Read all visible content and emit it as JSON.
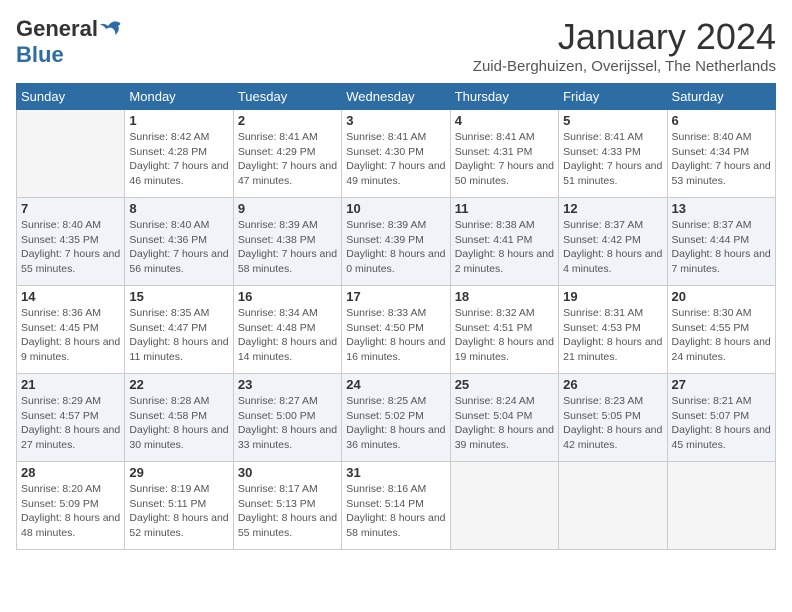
{
  "header": {
    "logo_general": "General",
    "logo_blue": "Blue",
    "month_title": "January 2024",
    "subtitle": "Zuid-Berghuizen, Overijssel, The Netherlands"
  },
  "days_of_week": [
    "Sunday",
    "Monday",
    "Tuesday",
    "Wednesday",
    "Thursday",
    "Friday",
    "Saturday"
  ],
  "weeks": [
    [
      {
        "num": "",
        "sunrise": "",
        "sunset": "",
        "daylight": "",
        "empty": true
      },
      {
        "num": "1",
        "sunrise": "Sunrise: 8:42 AM",
        "sunset": "Sunset: 4:28 PM",
        "daylight": "Daylight: 7 hours and 46 minutes."
      },
      {
        "num": "2",
        "sunrise": "Sunrise: 8:41 AM",
        "sunset": "Sunset: 4:29 PM",
        "daylight": "Daylight: 7 hours and 47 minutes."
      },
      {
        "num": "3",
        "sunrise": "Sunrise: 8:41 AM",
        "sunset": "Sunset: 4:30 PM",
        "daylight": "Daylight: 7 hours and 49 minutes."
      },
      {
        "num": "4",
        "sunrise": "Sunrise: 8:41 AM",
        "sunset": "Sunset: 4:31 PM",
        "daylight": "Daylight: 7 hours and 50 minutes."
      },
      {
        "num": "5",
        "sunrise": "Sunrise: 8:41 AM",
        "sunset": "Sunset: 4:33 PM",
        "daylight": "Daylight: 7 hours and 51 minutes."
      },
      {
        "num": "6",
        "sunrise": "Sunrise: 8:40 AM",
        "sunset": "Sunset: 4:34 PM",
        "daylight": "Daylight: 7 hours and 53 minutes."
      }
    ],
    [
      {
        "num": "7",
        "sunrise": "Sunrise: 8:40 AM",
        "sunset": "Sunset: 4:35 PM",
        "daylight": "Daylight: 7 hours and 55 minutes."
      },
      {
        "num": "8",
        "sunrise": "Sunrise: 8:40 AM",
        "sunset": "Sunset: 4:36 PM",
        "daylight": "Daylight: 7 hours and 56 minutes."
      },
      {
        "num": "9",
        "sunrise": "Sunrise: 8:39 AM",
        "sunset": "Sunset: 4:38 PM",
        "daylight": "Daylight: 7 hours and 58 minutes."
      },
      {
        "num": "10",
        "sunrise": "Sunrise: 8:39 AM",
        "sunset": "Sunset: 4:39 PM",
        "daylight": "Daylight: 8 hours and 0 minutes."
      },
      {
        "num": "11",
        "sunrise": "Sunrise: 8:38 AM",
        "sunset": "Sunset: 4:41 PM",
        "daylight": "Daylight: 8 hours and 2 minutes."
      },
      {
        "num": "12",
        "sunrise": "Sunrise: 8:37 AM",
        "sunset": "Sunset: 4:42 PM",
        "daylight": "Daylight: 8 hours and 4 minutes."
      },
      {
        "num": "13",
        "sunrise": "Sunrise: 8:37 AM",
        "sunset": "Sunset: 4:44 PM",
        "daylight": "Daylight: 8 hours and 7 minutes."
      }
    ],
    [
      {
        "num": "14",
        "sunrise": "Sunrise: 8:36 AM",
        "sunset": "Sunset: 4:45 PM",
        "daylight": "Daylight: 8 hours and 9 minutes."
      },
      {
        "num": "15",
        "sunrise": "Sunrise: 8:35 AM",
        "sunset": "Sunset: 4:47 PM",
        "daylight": "Daylight: 8 hours and 11 minutes."
      },
      {
        "num": "16",
        "sunrise": "Sunrise: 8:34 AM",
        "sunset": "Sunset: 4:48 PM",
        "daylight": "Daylight: 8 hours and 14 minutes."
      },
      {
        "num": "17",
        "sunrise": "Sunrise: 8:33 AM",
        "sunset": "Sunset: 4:50 PM",
        "daylight": "Daylight: 8 hours and 16 minutes."
      },
      {
        "num": "18",
        "sunrise": "Sunrise: 8:32 AM",
        "sunset": "Sunset: 4:51 PM",
        "daylight": "Daylight: 8 hours and 19 minutes."
      },
      {
        "num": "19",
        "sunrise": "Sunrise: 8:31 AM",
        "sunset": "Sunset: 4:53 PM",
        "daylight": "Daylight: 8 hours and 21 minutes."
      },
      {
        "num": "20",
        "sunrise": "Sunrise: 8:30 AM",
        "sunset": "Sunset: 4:55 PM",
        "daylight": "Daylight: 8 hours and 24 minutes."
      }
    ],
    [
      {
        "num": "21",
        "sunrise": "Sunrise: 8:29 AM",
        "sunset": "Sunset: 4:57 PM",
        "daylight": "Daylight: 8 hours and 27 minutes."
      },
      {
        "num": "22",
        "sunrise": "Sunrise: 8:28 AM",
        "sunset": "Sunset: 4:58 PM",
        "daylight": "Daylight: 8 hours and 30 minutes."
      },
      {
        "num": "23",
        "sunrise": "Sunrise: 8:27 AM",
        "sunset": "Sunset: 5:00 PM",
        "daylight": "Daylight: 8 hours and 33 minutes."
      },
      {
        "num": "24",
        "sunrise": "Sunrise: 8:25 AM",
        "sunset": "Sunset: 5:02 PM",
        "daylight": "Daylight: 8 hours and 36 minutes."
      },
      {
        "num": "25",
        "sunrise": "Sunrise: 8:24 AM",
        "sunset": "Sunset: 5:04 PM",
        "daylight": "Daylight: 8 hours and 39 minutes."
      },
      {
        "num": "26",
        "sunrise": "Sunrise: 8:23 AM",
        "sunset": "Sunset: 5:05 PM",
        "daylight": "Daylight: 8 hours and 42 minutes."
      },
      {
        "num": "27",
        "sunrise": "Sunrise: 8:21 AM",
        "sunset": "Sunset: 5:07 PM",
        "daylight": "Daylight: 8 hours and 45 minutes."
      }
    ],
    [
      {
        "num": "28",
        "sunrise": "Sunrise: 8:20 AM",
        "sunset": "Sunset: 5:09 PM",
        "daylight": "Daylight: 8 hours and 48 minutes."
      },
      {
        "num": "29",
        "sunrise": "Sunrise: 8:19 AM",
        "sunset": "Sunset: 5:11 PM",
        "daylight": "Daylight: 8 hours and 52 minutes."
      },
      {
        "num": "30",
        "sunrise": "Sunrise: 8:17 AM",
        "sunset": "Sunset: 5:13 PM",
        "daylight": "Daylight: 8 hours and 55 minutes."
      },
      {
        "num": "31",
        "sunrise": "Sunrise: 8:16 AM",
        "sunset": "Sunset: 5:14 PM",
        "daylight": "Daylight: 8 hours and 58 minutes."
      },
      {
        "num": "",
        "sunrise": "",
        "sunset": "",
        "daylight": "",
        "empty": true
      },
      {
        "num": "",
        "sunrise": "",
        "sunset": "",
        "daylight": "",
        "empty": true
      },
      {
        "num": "",
        "sunrise": "",
        "sunset": "",
        "daylight": "",
        "empty": true
      }
    ]
  ]
}
